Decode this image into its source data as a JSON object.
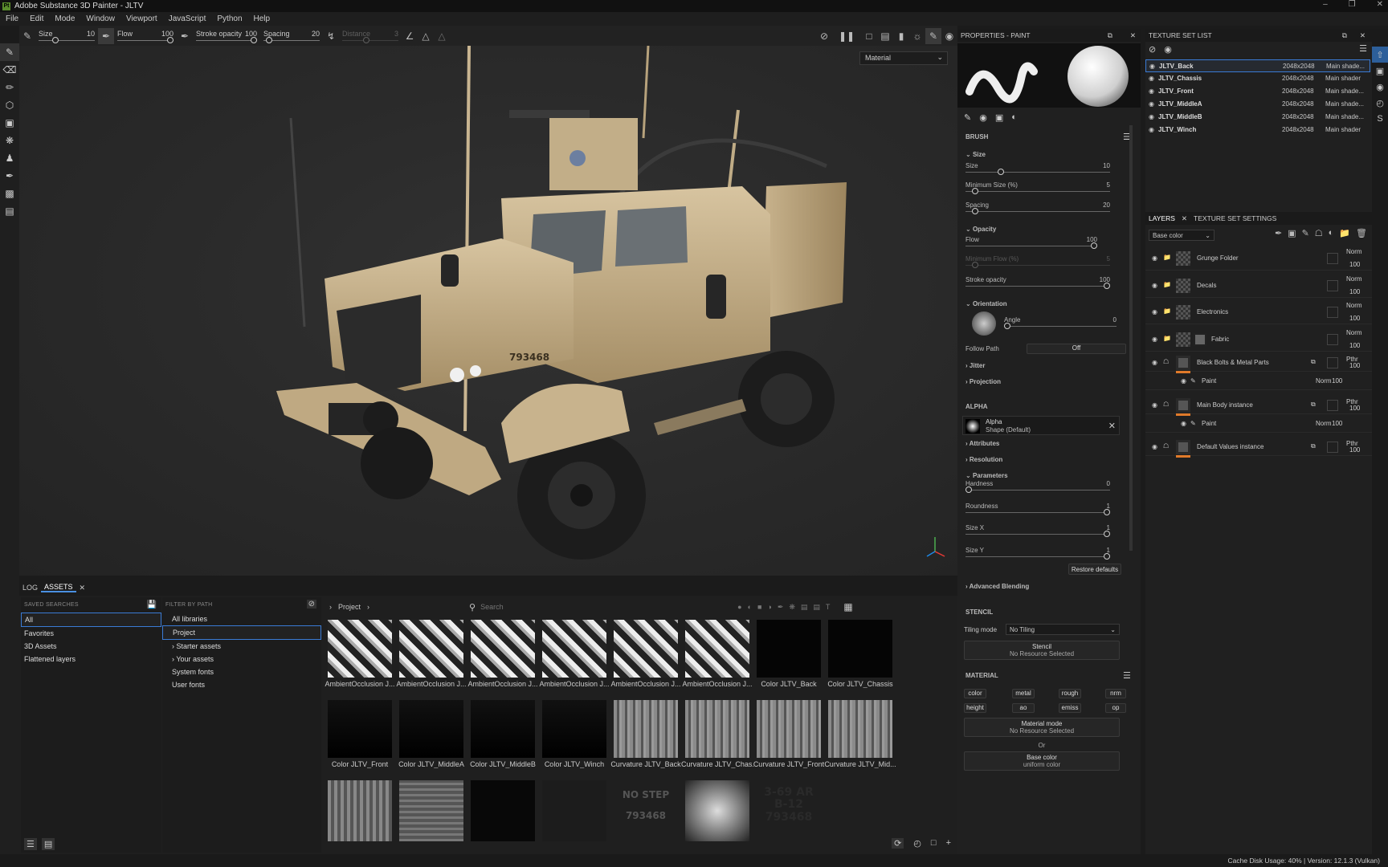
{
  "app": {
    "title": "Adobe Substance 3D Painter - JLTV",
    "logo_text": "Pt"
  },
  "menu": [
    "File",
    "Edit",
    "Mode",
    "Window",
    "Viewport",
    "JavaScript",
    "Python",
    "Help"
  ],
  "toolbar": {
    "size": {
      "label": "Size",
      "value": "10",
      "fraction": 0.3
    },
    "flow": {
      "label": "Flow",
      "value": "100",
      "fraction": 1.0
    },
    "stroke_opacity": {
      "label": "Stroke opacity",
      "value": "100",
      "fraction": 1.0
    },
    "spacing": {
      "label": "Spacing",
      "value": "20",
      "fraction": 0.05
    },
    "distance": {
      "label": "Distance",
      "value": "3"
    }
  },
  "viewport": {
    "display_mode": "Material",
    "vehicle_number": "793468"
  },
  "assets": {
    "tabs": [
      "LOG",
      "ASSETS"
    ],
    "saved_searches_title": "SAVED SEARCHES",
    "saved_searches": [
      "All",
      "Favorites",
      "3D Assets",
      "Flattened layers"
    ],
    "filter_title": "FILTER BY PATH",
    "filter_items": [
      "All libraries",
      "Project",
      "Starter assets",
      "Your assets",
      "System fonts",
      "User fonts"
    ],
    "breadcrumb": "Project",
    "search_placeholder": "Search",
    "thumbs_row1": [
      "AmbientOcclusion J...",
      "AmbientOcclusion J...",
      "AmbientOcclusion J...",
      "AmbientOcclusion J...",
      "AmbientOcclusion J...",
      "AmbientOcclusion J...",
      "Color JLTV_Back",
      "Color JLTV_Chassis"
    ],
    "thumbs_row2": [
      "Color JLTV_Front",
      "Color JLTV_MiddleA",
      "Color JLTV_MiddleB",
      "Color JLTV_Winch",
      "Curvature JLTV_Back",
      "Curvature JLTV_Chas...",
      "Curvature JLTV_Front",
      "Curvature JLTV_Mid..."
    ],
    "decal_texts": {
      "no_step": "NO STEP",
      "number": "793468",
      "marking": "3-69 AR\nB-12\n793468"
    }
  },
  "properties": {
    "title": "PROPERTIES - PAINT",
    "brush_title": "BRUSH",
    "size_section": "Size",
    "size": {
      "label": "Size",
      "value": "10",
      "fraction": 0.22
    },
    "min_size": {
      "label": "Minimum Size (%)",
      "value": "5",
      "fraction": 0.05
    },
    "spacing": {
      "label": "Spacing",
      "value": "20",
      "fraction": 0.05
    },
    "opacity_section": "Opacity",
    "flow": {
      "label": "Flow",
      "value": "100",
      "fraction": 0.98
    },
    "min_flow": {
      "label": "Minimum Flow (%)",
      "value": "5"
    },
    "stroke_opacity": {
      "label": "Stroke opacity",
      "value": "100",
      "fraction": 1.0
    },
    "orientation_section": "Orientation",
    "angle": {
      "label": "Angle",
      "value": "0"
    },
    "follow_path": {
      "label": "Follow Path",
      "value": "Off"
    },
    "jitter": "Jitter",
    "projection": "Projection",
    "alpha_title": "ALPHA",
    "alpha_name": "Alpha",
    "alpha_shape": "Shape (Default)",
    "attributes": "Attributes",
    "resolution": "Resolution",
    "parameters": "Parameters",
    "hardness": {
      "label": "Hardness",
      "value": "0",
      "fraction": 0.0
    },
    "roundness": {
      "label": "Roundness",
      "value": "1",
      "fraction": 1.0
    },
    "sizex": {
      "label": "Size X",
      "value": "1",
      "fraction": 1.0
    },
    "sizey": {
      "label": "Size Y",
      "value": "1",
      "fraction": 1.0
    },
    "restore": "Restore defaults",
    "advanced_blending": "Advanced Blending",
    "stencil_title": "STENCIL",
    "tiling_label": "Tiling mode",
    "tiling_value": "No Tiling",
    "stencil_btn": "Stencil",
    "stencil_sub": "No Resource Selected",
    "material_title": "MATERIAL",
    "channels": [
      "color",
      "metal",
      "rough",
      "nrm",
      "height",
      "ao",
      "emiss",
      "op"
    ],
    "material_mode": "Material mode",
    "material_mode_sub": "No Resource Selected",
    "or": "Or",
    "base_color": "Base color",
    "base_color_sub": "uniform color"
  },
  "texture_sets": {
    "title": "TEXTURE SET LIST",
    "items": [
      {
        "name": "JLTV_Back",
        "res": "2048x2048",
        "shader": "Main shade..."
      },
      {
        "name": "JLTV_Chassis",
        "res": "2048x2048",
        "shader": "Main shader"
      },
      {
        "name": "JLTV_Front",
        "res": "2048x2048",
        "shader": "Main shade..."
      },
      {
        "name": "JLTV_MiddleA",
        "res": "2048x2048",
        "shader": "Main shade..."
      },
      {
        "name": "JLTV_MiddleB",
        "res": "2048x2048",
        "shader": "Main shade..."
      },
      {
        "name": "JLTV_Winch",
        "res": "2048x2048",
        "shader": "Main shader"
      }
    ]
  },
  "layers": {
    "tabs": [
      "LAYERS",
      "TEXTURE SET SETTINGS"
    ],
    "channel": "Base color",
    "items": [
      {
        "name": "Grunge Folder",
        "blend": "Norm",
        "opacity": "100"
      },
      {
        "name": "Decals",
        "blend": "Norm",
        "opacity": "100"
      },
      {
        "name": "Electronics",
        "blend": "Norm",
        "opacity": "100"
      },
      {
        "name": "Fabric",
        "blend": "Norm",
        "opacity": "100"
      },
      {
        "name": "Black Bolts & Metal Parts",
        "blend": "Pthr",
        "opacity": "100"
      },
      {
        "name": "Paint",
        "blend": "Norm",
        "opacity": "100"
      },
      {
        "name": "Main Body instance",
        "blend": "Pthr",
        "opacity": "100"
      },
      {
        "name": "Paint",
        "blend": "Norm",
        "opacity": "100"
      },
      {
        "name": "Default Values instance",
        "blend": "Pthr",
        "opacity": "100"
      }
    ]
  },
  "status": {
    "text": "Cache Disk Usage:  40% | Version: 12.1.3 (Vulkan)"
  }
}
